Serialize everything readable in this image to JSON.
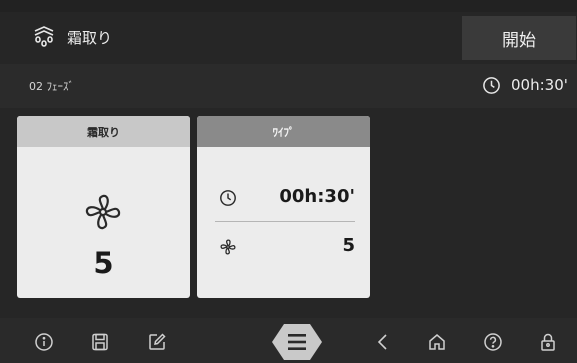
{
  "header": {
    "mode_icon": "defrost-icon",
    "title": "霜取り",
    "start_label": "開始"
  },
  "phase": {
    "label": "02 ﾌｪｰｽﾞ",
    "icon": "clock-icon",
    "time": "00h:30'"
  },
  "cards": [
    {
      "title": "霜取り",
      "icon": "fan-icon",
      "value": "5"
    },
    {
      "title": "ﾜｲﾌﾟ",
      "rows": [
        {
          "icon": "clock-icon",
          "value": "00h:30'"
        },
        {
          "icon": "fan-icon",
          "value": "5"
        }
      ]
    }
  ],
  "bottom_bar": {
    "icons": [
      "info-icon",
      "save-icon",
      "edit-icon",
      "menu-icon",
      "back-icon",
      "home-icon",
      "help-icon",
      "lock-icon"
    ]
  },
  "colors": {
    "background": "#222222",
    "card": "#ececec",
    "card_header_active": "#c8c8c8",
    "card_header_secondary": "#8a8a8a",
    "menu_hex": "#c9c9c9"
  }
}
